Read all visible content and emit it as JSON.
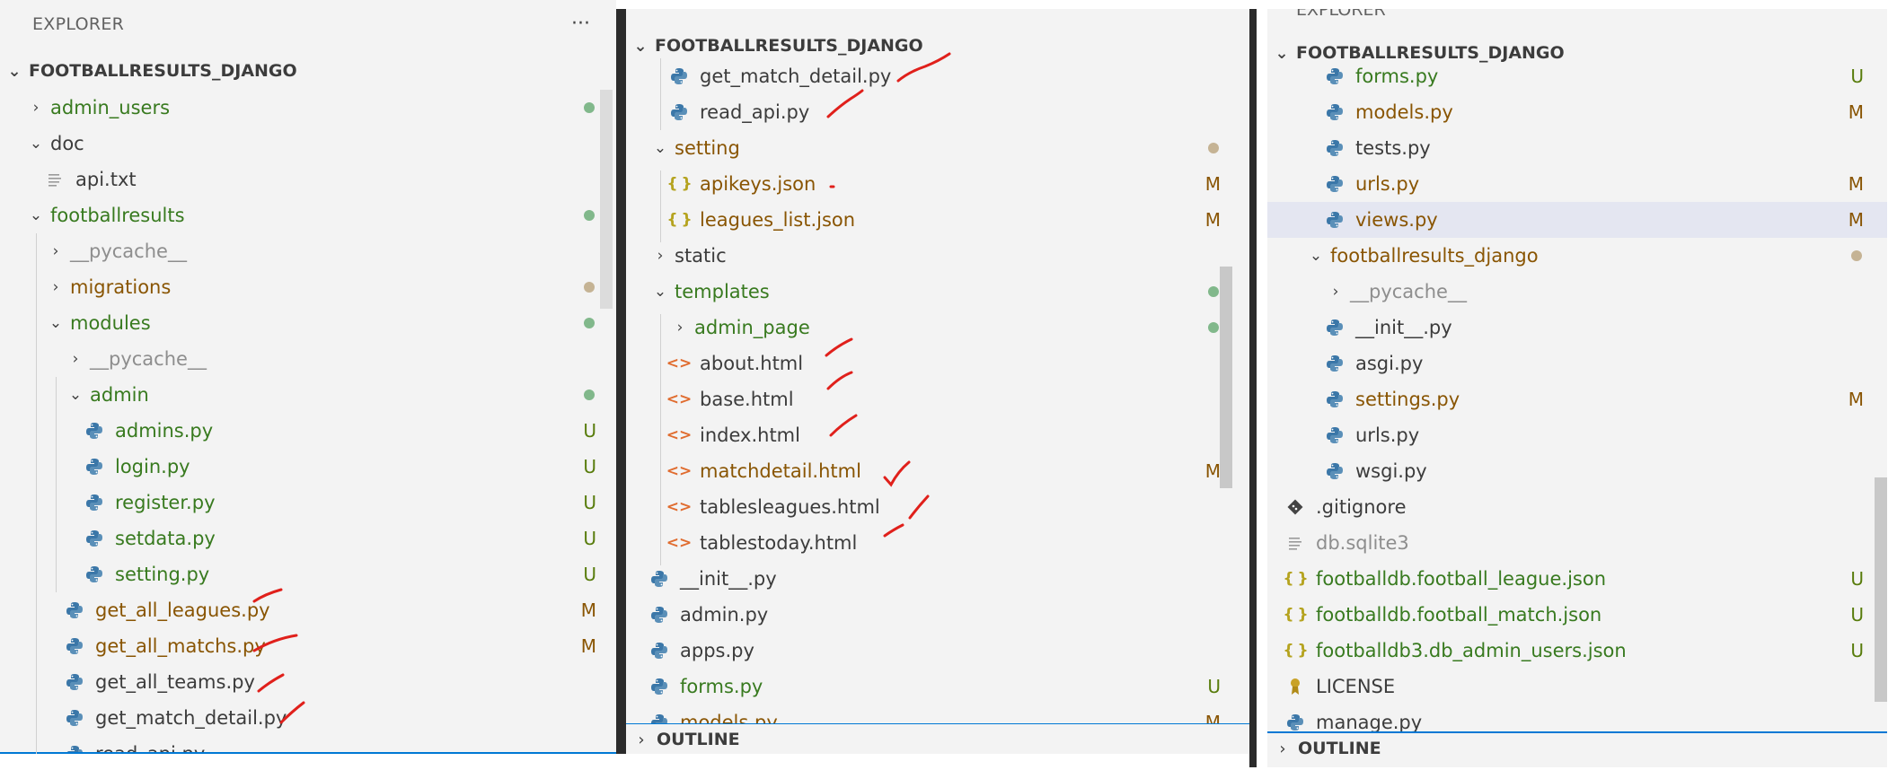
{
  "panel1": {
    "explorer_title": "EXPLORER",
    "more_actions": "···",
    "root": "FOOTBALLRESULTS_DJANGO",
    "items": [
      {
        "label": "admin_users",
        "chev": "›",
        "icon": "",
        "color": "green",
        "status": "dot-green"
      },
      {
        "label": "doc",
        "chev": "⌄",
        "icon": "",
        "color": "plain",
        "status": ""
      },
      {
        "label": "api.txt",
        "chev": "",
        "icon": "text-file-icon",
        "color": "plain",
        "status": ""
      },
      {
        "label": "footballresults",
        "chev": "⌄",
        "icon": "",
        "color": "green",
        "status": "dot-green"
      },
      {
        "label": "__pycache__",
        "chev": "›",
        "icon": "",
        "color": "gray",
        "status": ""
      },
      {
        "label": "migrations",
        "chev": "›",
        "icon": "",
        "color": "olive",
        "status": "dot-brown"
      },
      {
        "label": "modules",
        "chev": "⌄",
        "icon": "",
        "color": "green",
        "status": "dot-green"
      },
      {
        "label": "__pycache__",
        "chev": "›",
        "icon": "",
        "color": "gray",
        "status": ""
      },
      {
        "label": "admin",
        "chev": "⌄",
        "icon": "",
        "color": "green",
        "status": "dot-green"
      },
      {
        "label": "admins.py",
        "chev": "",
        "icon": "python-icon",
        "color": "green",
        "status": "U"
      },
      {
        "label": "login.py",
        "chev": "",
        "icon": "python-icon",
        "color": "green",
        "status": "U"
      },
      {
        "label": "register.py",
        "chev": "",
        "icon": "python-icon",
        "color": "green",
        "status": "U"
      },
      {
        "label": "setdata.py",
        "chev": "",
        "icon": "python-icon",
        "color": "green",
        "status": "U"
      },
      {
        "label": "setting.py",
        "chev": "",
        "icon": "python-icon",
        "color": "green",
        "status": "U"
      },
      {
        "label": "get_all_leagues.py",
        "chev": "",
        "icon": "python-icon",
        "color": "olive",
        "status": "M"
      },
      {
        "label": "get_all_matchs.py",
        "chev": "",
        "icon": "python-icon",
        "color": "olive",
        "status": "M"
      },
      {
        "label": "get_all_teams.py",
        "chev": "",
        "icon": "python-icon",
        "color": "plain",
        "status": ""
      },
      {
        "label": "get_match_detail.py",
        "chev": "",
        "icon": "python-icon",
        "color": "plain",
        "status": ""
      },
      {
        "label": "read_api.py",
        "chev": "",
        "icon": "python-icon",
        "color": "plain",
        "status": ""
      }
    ]
  },
  "panel2": {
    "root": "FOOTBALLRESULTS_DJANGO",
    "items": [
      {
        "label": "get_match_detail.py",
        "chev": "",
        "icon": "python-icon",
        "color": "plain",
        "status": ""
      },
      {
        "label": "read_api.py",
        "chev": "",
        "icon": "python-icon",
        "color": "plain",
        "status": ""
      },
      {
        "label": "setting",
        "chev": "⌄",
        "icon": "",
        "color": "olive",
        "status": "dot-brown"
      },
      {
        "label": "apikeys.json",
        "chev": "",
        "icon": "json-icon",
        "color": "olive",
        "status": "M"
      },
      {
        "label": "leagues_list.json",
        "chev": "",
        "icon": "json-icon",
        "color": "olive",
        "status": "M"
      },
      {
        "label": "static",
        "chev": "›",
        "icon": "",
        "color": "plain",
        "status": ""
      },
      {
        "label": "templates",
        "chev": "⌄",
        "icon": "",
        "color": "green",
        "status": "dot-green"
      },
      {
        "label": "admin_page",
        "chev": "›",
        "icon": "",
        "color": "green",
        "status": "dot-green"
      },
      {
        "label": "about.html",
        "chev": "",
        "icon": "html-icon",
        "color": "plain",
        "status": ""
      },
      {
        "label": "base.html",
        "chev": "",
        "icon": "html-icon",
        "color": "plain",
        "status": ""
      },
      {
        "label": "index.html",
        "chev": "",
        "icon": "html-icon",
        "color": "plain",
        "status": ""
      },
      {
        "label": "matchdetail.html",
        "chev": "",
        "icon": "html-icon",
        "color": "olive",
        "status": "M"
      },
      {
        "label": "tablesleagues.html",
        "chev": "",
        "icon": "html-icon",
        "color": "plain",
        "status": ""
      },
      {
        "label": "tablestoday.html",
        "chev": "",
        "icon": "html-icon",
        "color": "plain",
        "status": ""
      },
      {
        "label": "__init__.py",
        "chev": "",
        "icon": "python-icon",
        "color": "plain",
        "status": ""
      },
      {
        "label": "admin.py",
        "chev": "",
        "icon": "python-icon",
        "color": "plain",
        "status": ""
      },
      {
        "label": "apps.py",
        "chev": "",
        "icon": "python-icon",
        "color": "plain",
        "status": ""
      },
      {
        "label": "forms.py",
        "chev": "",
        "icon": "python-icon",
        "color": "green",
        "status": "U"
      },
      {
        "label": "models.py",
        "chev": "",
        "icon": "python-icon",
        "color": "olive",
        "status": "M"
      }
    ],
    "outline": "OUTLINE"
  },
  "panel3": {
    "explorer_title": "EXPLORER",
    "root": "FOOTBALLRESULTS_DJANGO",
    "items": [
      {
        "label": "forms.py",
        "chev": "",
        "icon": "python-icon",
        "color": "green",
        "status": "U"
      },
      {
        "label": "models.py",
        "chev": "",
        "icon": "python-icon",
        "color": "olive",
        "status": "M"
      },
      {
        "label": "tests.py",
        "chev": "",
        "icon": "python-icon",
        "color": "plain",
        "status": ""
      },
      {
        "label": "urls.py",
        "chev": "",
        "icon": "python-icon",
        "color": "olive",
        "status": "M"
      },
      {
        "label": "views.py",
        "chev": "",
        "icon": "python-icon",
        "color": "olive",
        "status": "M"
      },
      {
        "label": "footballresults_django",
        "chev": "⌄",
        "icon": "",
        "color": "olive",
        "status": "dot-brown"
      },
      {
        "label": "__pycache__",
        "chev": "›",
        "icon": "",
        "color": "gray",
        "status": ""
      },
      {
        "label": "__init__.py",
        "chev": "",
        "icon": "python-icon",
        "color": "plain",
        "status": ""
      },
      {
        "label": "asgi.py",
        "chev": "",
        "icon": "python-icon",
        "color": "plain",
        "status": ""
      },
      {
        "label": "settings.py",
        "chev": "",
        "icon": "python-icon",
        "color": "olive",
        "status": "M"
      },
      {
        "label": "urls.py",
        "chev": "",
        "icon": "python-icon",
        "color": "plain",
        "status": ""
      },
      {
        "label": "wsgi.py",
        "chev": "",
        "icon": "python-icon",
        "color": "plain",
        "status": ""
      },
      {
        "label": ".gitignore",
        "chev": "",
        "icon": "git-icon",
        "color": "plain",
        "status": ""
      },
      {
        "label": "db.sqlite3",
        "chev": "",
        "icon": "text-file-icon",
        "color": "gray",
        "status": ""
      },
      {
        "label": "footballdb.football_league.json",
        "chev": "",
        "icon": "json-icon",
        "color": "green",
        "status": "U"
      },
      {
        "label": "footballdb.football_match.json",
        "chev": "",
        "icon": "json-icon",
        "color": "green",
        "status": "U"
      },
      {
        "label": "footballdb3.db_admin_users.json",
        "chev": "",
        "icon": "json-icon",
        "color": "green",
        "status": "U"
      },
      {
        "label": "LICENSE",
        "chev": "",
        "icon": "license-icon",
        "color": "plain",
        "status": ""
      },
      {
        "label": "manage.py",
        "chev": "",
        "icon": "python-icon",
        "color": "plain",
        "status": ""
      }
    ],
    "outline": "OUTLINE"
  },
  "colors": {
    "untracked": "#587c0c",
    "modified": "#895503",
    "annotation_red": "#e0201b",
    "selection": "#e4e6f1"
  }
}
